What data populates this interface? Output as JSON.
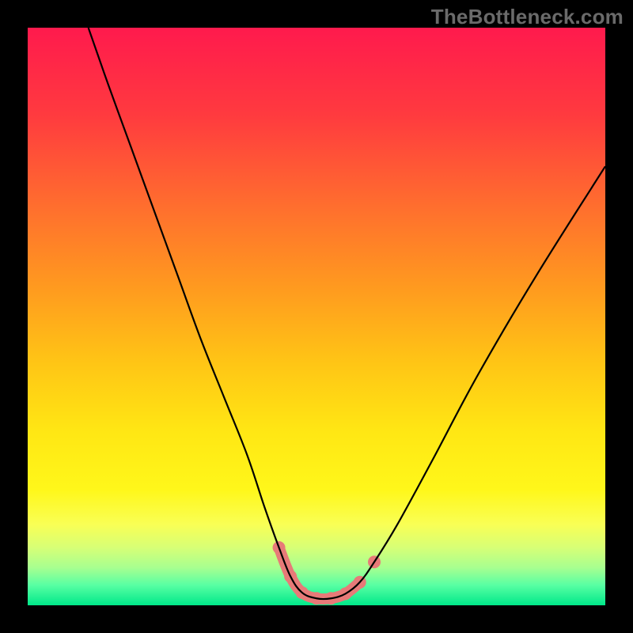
{
  "watermark": "TheBottleneck.com",
  "chart_data": {
    "type": "line",
    "title": "",
    "xlabel": "",
    "ylabel": "",
    "xlim": [
      0,
      100
    ],
    "ylim": [
      0,
      100
    ],
    "grid": false,
    "legend": false,
    "background_gradient": {
      "stops": [
        {
          "offset": 0.0,
          "color": "#ff1a4d"
        },
        {
          "offset": 0.15,
          "color": "#ff3a3f"
        },
        {
          "offset": 0.3,
          "color": "#ff6b2f"
        },
        {
          "offset": 0.45,
          "color": "#ff9a1f"
        },
        {
          "offset": 0.58,
          "color": "#ffc515"
        },
        {
          "offset": 0.7,
          "color": "#ffe714"
        },
        {
          "offset": 0.8,
          "color": "#fff71a"
        },
        {
          "offset": 0.86,
          "color": "#f9ff55"
        },
        {
          "offset": 0.9,
          "color": "#d7ff76"
        },
        {
          "offset": 0.935,
          "color": "#a7ff90"
        },
        {
          "offset": 0.965,
          "color": "#58ffa3"
        },
        {
          "offset": 1.0,
          "color": "#00e88a"
        }
      ]
    },
    "series": [
      {
        "name": "bottleneck-curve",
        "color": "#000000",
        "width": 2.2,
        "x": [
          10.5,
          14,
          18,
          22,
          26,
          30,
          34,
          38,
          41,
          43.5,
          45.5,
          47.5,
          50,
          52.5,
          55,
          57.5,
          60,
          64,
          70,
          78,
          88,
          100
        ],
        "y": [
          100,
          90,
          79,
          68,
          57,
          46,
          36,
          26,
          17,
          10,
          5,
          2.2,
          1.2,
          1.2,
          2.0,
          4.0,
          7.5,
          14,
          25,
          40,
          57,
          76
        ]
      },
      {
        "name": "highlight-band",
        "color": "#e77a78",
        "width": 14,
        "linecap": "round",
        "x": [
          43.5,
          45.5,
          47.5,
          50,
          52.5,
          55,
          57.5
        ],
        "y": [
          10,
          5,
          2.2,
          1.2,
          1.2,
          2.0,
          4.0
        ]
      }
    ],
    "highlight_points": {
      "color": "#e77a78",
      "radius": 8,
      "x": [
        43.5,
        45.5,
        47.5,
        50,
        52.5,
        55,
        57.5,
        60
      ],
      "y": [
        10,
        5,
        2.2,
        1.2,
        1.2,
        2.0,
        4.0,
        7.5
      ]
    }
  }
}
